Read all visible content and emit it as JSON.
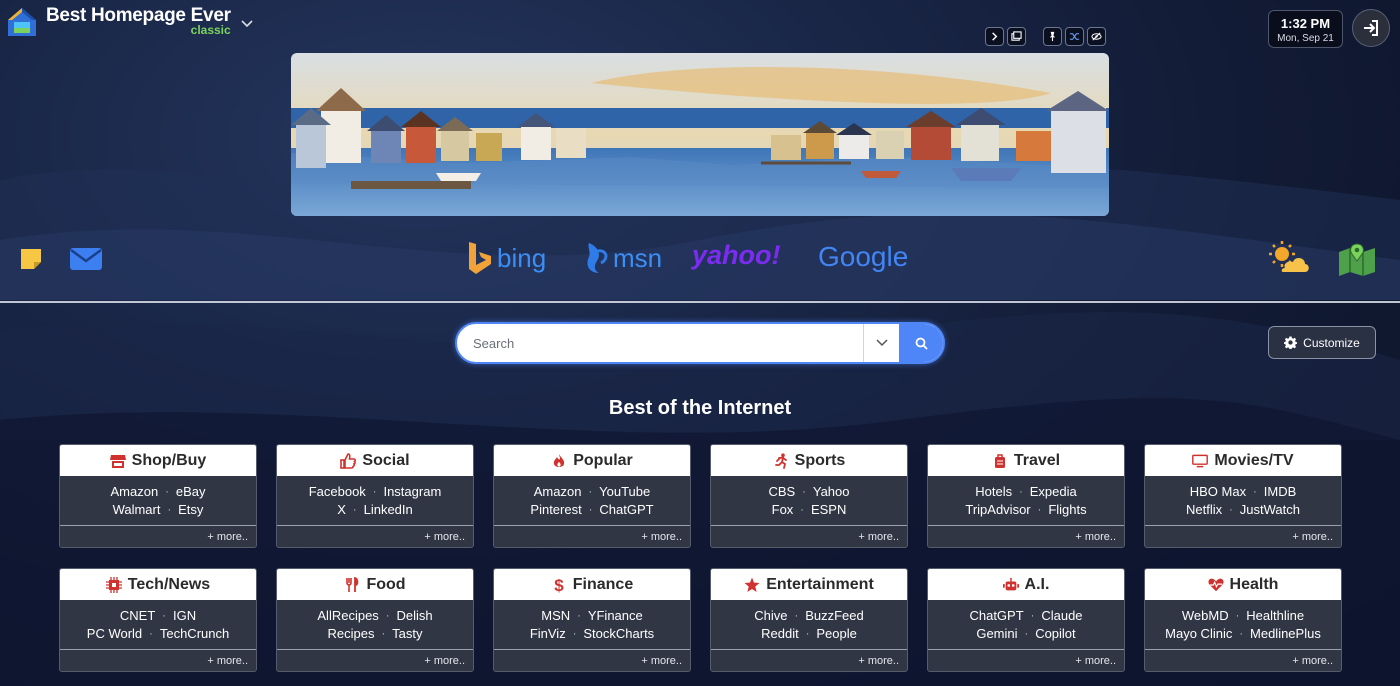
{
  "header": {
    "logo_title": "Best Homepage Ever",
    "logo_subtitle": "classic"
  },
  "clock": {
    "time": "1:32 PM",
    "date": "Mon, Sep 21"
  },
  "engines": [
    {
      "name": "bing",
      "color": "#3b8ff4"
    },
    {
      "name": "msn",
      "color": "#3b8ff4"
    },
    {
      "name": "yahoo!",
      "color": "#7b2cf0"
    },
    {
      "name": "Google",
      "color": "#4285f4"
    }
  ],
  "search": {
    "placeholder": "Search"
  },
  "customize_label": "Customize",
  "section_title": "Best of the Internet",
  "more_label": "+ more..",
  "categories": [
    {
      "title": "Shop/Buy",
      "icon": "store-icon",
      "rows": [
        [
          "Amazon",
          "eBay"
        ],
        [
          "Walmart",
          "Etsy"
        ]
      ]
    },
    {
      "title": "Social",
      "icon": "thumbs-up-icon",
      "rows": [
        [
          "Facebook",
          "Instagram"
        ],
        [
          "X",
          "LinkedIn"
        ]
      ]
    },
    {
      "title": "Popular",
      "icon": "fire-icon",
      "rows": [
        [
          "Amazon",
          "YouTube"
        ],
        [
          "Pinterest",
          "ChatGPT"
        ]
      ]
    },
    {
      "title": "Sports",
      "icon": "running-icon",
      "rows": [
        [
          "CBS",
          "Yahoo"
        ],
        [
          "Fox",
          "ESPN"
        ]
      ]
    },
    {
      "title": "Travel",
      "icon": "suitcase-icon",
      "rows": [
        [
          "Hotels",
          "Expedia"
        ],
        [
          "TripAdvisor",
          "Flights"
        ]
      ]
    },
    {
      "title": "Movies/TV",
      "icon": "tv-icon",
      "rows": [
        [
          "HBO Max",
          "IMDB"
        ],
        [
          "Netflix",
          "JustWatch"
        ]
      ]
    },
    {
      "title": "Tech/News",
      "icon": "chip-icon",
      "rows": [
        [
          "CNET",
          "IGN"
        ],
        [
          "PC World",
          "TechCrunch"
        ]
      ]
    },
    {
      "title": "Food",
      "icon": "utensils-icon",
      "rows": [
        [
          "AllRecipes",
          "Delish"
        ],
        [
          "Recipes",
          "Tasty"
        ]
      ]
    },
    {
      "title": "Finance",
      "icon": "dollar-icon",
      "rows": [
        [
          "MSN",
          "YFinance"
        ],
        [
          "FinViz",
          "StockCharts"
        ]
      ]
    },
    {
      "title": "Entertainment",
      "icon": "star-icon",
      "rows": [
        [
          "Chive",
          "BuzzFeed"
        ],
        [
          "Reddit",
          "People"
        ]
      ]
    },
    {
      "title": "A.I.",
      "icon": "robot-icon",
      "rows": [
        [
          "ChatGPT",
          "Claude"
        ],
        [
          "Gemini",
          "Copilot"
        ]
      ]
    },
    {
      "title": "Health",
      "icon": "heartbeat-icon",
      "rows": [
        [
          "WebMD",
          "Healthline"
        ],
        [
          "Mayo Clinic",
          "MedlinePlus"
        ]
      ]
    }
  ],
  "colors": {
    "accent": "#4f86f7",
    "icon_red": "#d0332f",
    "background": "#121b35"
  }
}
